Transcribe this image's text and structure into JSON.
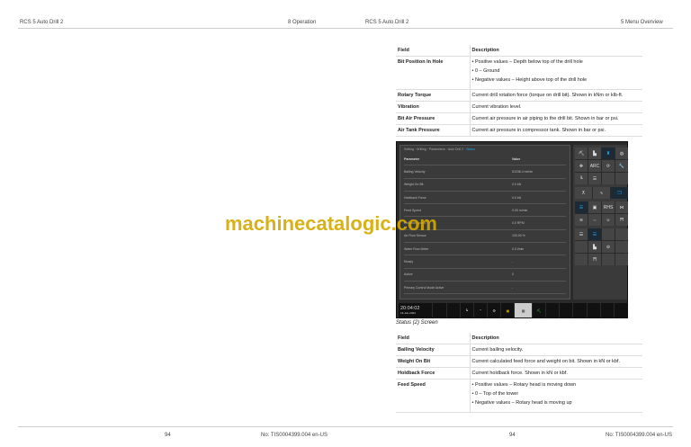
{
  "header": {
    "left_title": "RCS 5 Auto Drill 2",
    "left_section": "8 Operation",
    "right_title": "RCS 5 Auto Drill 2",
    "right_section": "5 Menu Overview"
  },
  "table1": {
    "col_field": "Field",
    "col_desc": "Description",
    "rows": [
      {
        "field": "Bit Position In Hole",
        "bullets": [
          "Positive values – Depth below top of the drill hole",
          "0 – Ground",
          "Negative values – Height above top of the drill hole"
        ]
      },
      {
        "field": "Rotary Torque",
        "desc": "Current drill rotation force (torque on drill bit). Shown in kNm or klb-ft."
      },
      {
        "field": "Vibration",
        "desc": "Current vibration level."
      },
      {
        "field": "Bit Air Pressure",
        "desc": "Current air pressure in air piping to the drill bit. Shown in bar or psi."
      },
      {
        "field": "Air Tank Pressure",
        "desc": "Current air pressure in compressor tank. Shown in bar or psi."
      }
    ]
  },
  "screen": {
    "breadcrumb": "Setting · Drilling · Parameters · Auto Drill 2 ·",
    "breadcrumb_active": "Status",
    "col_param": "Parameter",
    "col_value": "Value",
    "rows": [
      [
        "Bailing Velocity",
        "51238.4 m/min"
      ],
      [
        "Weight On Bit",
        "0.0 kN"
      ],
      [
        "Holdback Force",
        "0.0 kN"
      ],
      [
        "Feed Speed",
        "0.00 m/min"
      ],
      [
        "Rotation Speed",
        "0.0 RPM"
      ],
      [
        "Air Flow Sensor",
        "100.00 %"
      ],
      [
        "Water Flow Meter",
        "0.0 l/min"
      ],
      [
        "Ready",
        "-"
      ],
      [
        "Active",
        "0"
      ],
      [
        "Primary Control Mode Active",
        "-"
      ]
    ],
    "time": "20:04:02",
    "date": "13-Jun-2024",
    "icons": [
      "ARC",
      "RHS"
    ]
  },
  "caption": "Status (2) Screen",
  "table2": {
    "col_field": "Field",
    "col_desc": "Description",
    "rows": [
      {
        "field": "Bailing Velocity",
        "desc": "Current bailing velocity."
      },
      {
        "field": "Weight On Bit",
        "desc": "Current calculated feed force and weight on bit. Shown in kN or kbf."
      },
      {
        "field": "Holdback Force",
        "desc": "Current holdback force. Shown in kN or kbf."
      },
      {
        "field": "Feed Speed",
        "bullets": [
          "Positive values – Rotary head is moving down",
          "0 – Top of the tower",
          "Negative values – Rotary head is moving up"
        ]
      }
    ]
  },
  "footer": {
    "left_page": "94",
    "left_doc": "No: TIS0004399.004 en-US",
    "right_page": "94",
    "right_doc": "No: TIS0004399.004 en-US"
  },
  "watermark": "machinecatalogic.com"
}
